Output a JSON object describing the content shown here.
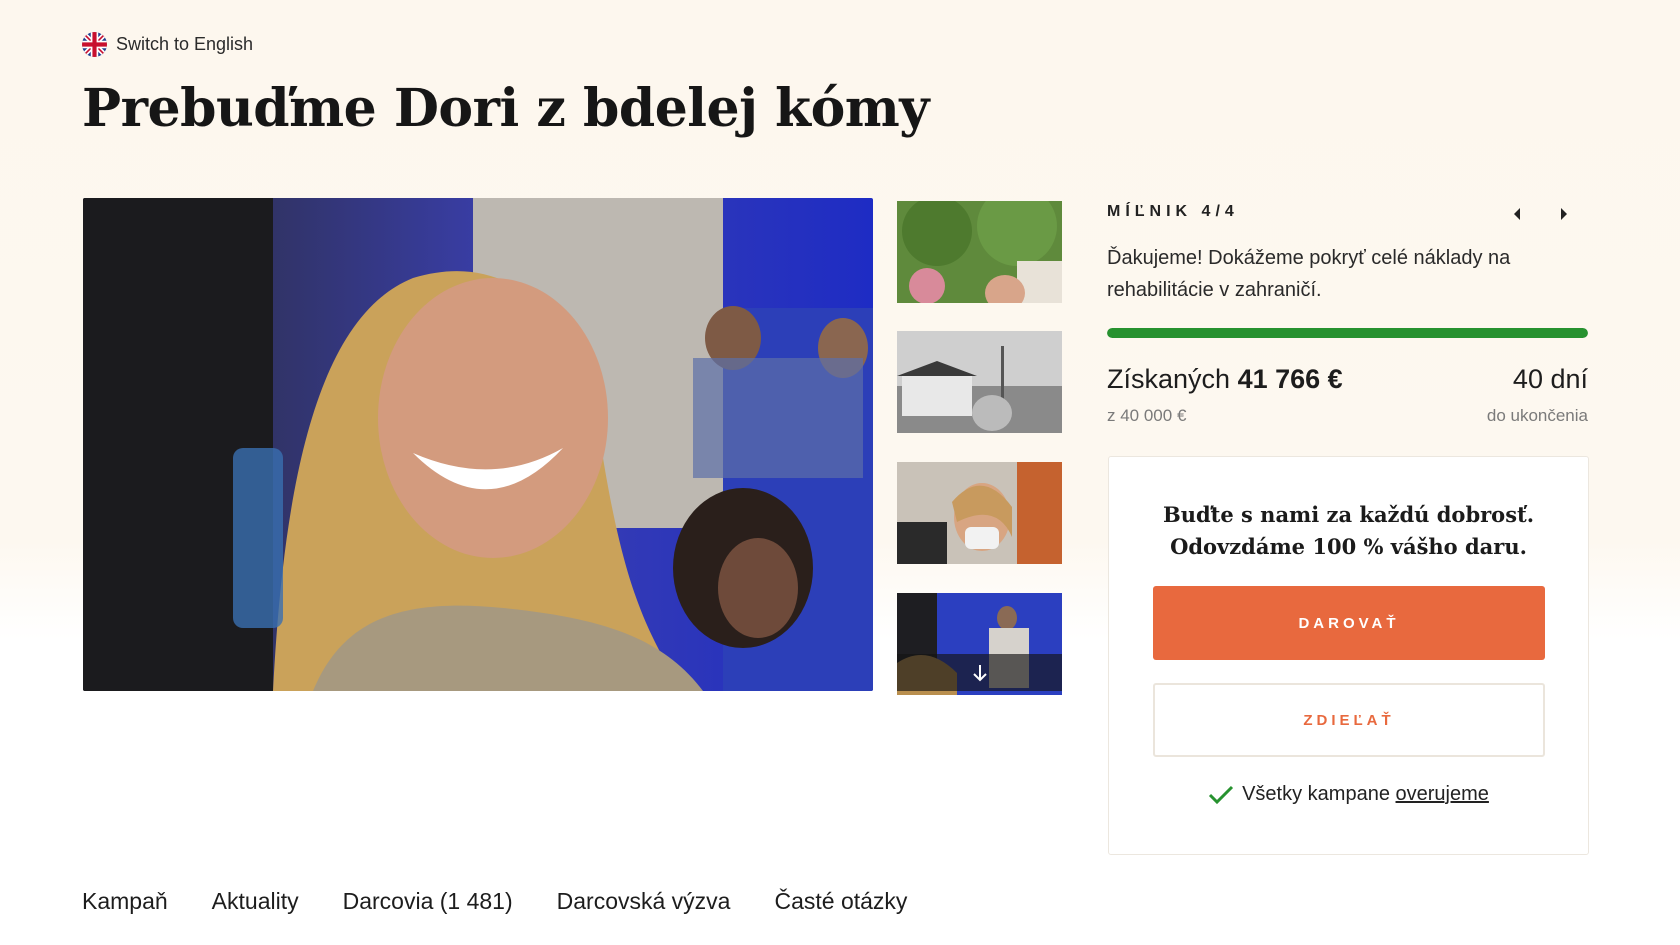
{
  "lang_switch": {
    "label": "Switch to English",
    "icon": "uk-flag-icon"
  },
  "title": "Prebuďme Dori z bdelej kómy",
  "milestone": {
    "label": "MÍĽNIK 4/4",
    "text": "Ďakujeme! Dokážeme pokryť celé náklady na rehabilitácie v zahraničí.",
    "progress_percent": 100
  },
  "stats": {
    "raised_label": "Získaných",
    "raised_amount": "41 766 €",
    "goal": "z  40 000 €",
    "days": "40 dní",
    "days_label": "do ukončenia"
  },
  "donate_card": {
    "heading_line1": "Buďte s nami za každú dobrosť.",
    "heading_line2": "Odovzdáme 100 % vášho daru.",
    "donate_label": "DAROVAŤ",
    "share_label": "ZDIEĽAŤ",
    "verified_text": "Všetky kampane",
    "verified_link": "overujeme"
  },
  "tabs": [
    "Kampaň",
    "Aktuality",
    "Darcovia (1 481)",
    "Darcovská výzva",
    "Časté otázky"
  ],
  "colors": {
    "accent": "#e8693e",
    "progress": "#27922f",
    "background": "#fdf7ee"
  }
}
